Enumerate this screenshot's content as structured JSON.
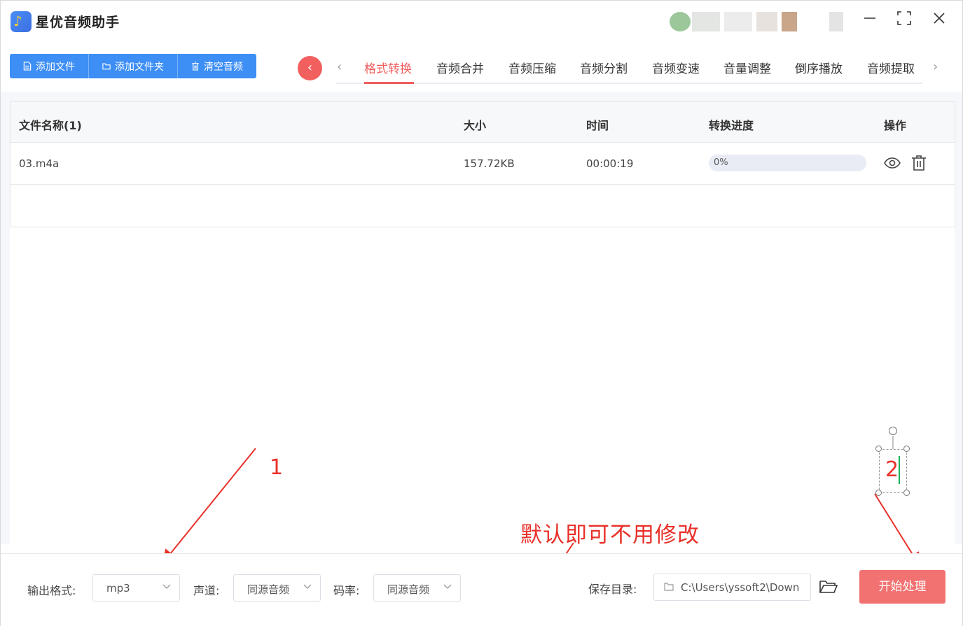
{
  "app": {
    "title": "星优音频助手"
  },
  "window_controls": {
    "minimize": "—",
    "maximize": "⛶",
    "close": "✕"
  },
  "toolbar": {
    "add_file": "添加文件",
    "add_folder": "添加文件夹",
    "clear_audio": "清空音频"
  },
  "nav": {
    "tabs": [
      "格式转换",
      "音频合并",
      "音频压缩",
      "音频分割",
      "音频变速",
      "音量调整",
      "倒序播放",
      "音频提取"
    ],
    "active_tab": "格式转换"
  },
  "table": {
    "headers": {
      "name": "文件名称(1)",
      "size": "大小",
      "time": "时间",
      "progress": "转换进度",
      "ops": "操作"
    },
    "rows": [
      {
        "name": "03.m4a",
        "size": "157.72KB",
        "time": "00:00:19",
        "progress_text": "0%",
        "progress": 0
      }
    ]
  },
  "bottom": {
    "output_format_label": "输出格式:",
    "output_format_value": "mp3",
    "channel_label": "声道:",
    "channel_value": "同源音频",
    "bitrate_label": "码率:",
    "bitrate_value": "同源音频",
    "save_dir_label": "保存目录:",
    "save_dir_value": "C:\\Users\\yssoft2\\Down",
    "start_button": "开始处理"
  },
  "annotations": {
    "step1": "1",
    "step2": "2",
    "note": "默认即可不用修改"
  },
  "colors": {
    "primary": "#3d8ef5",
    "accent": "#f05c5c",
    "start_button": "#f27171",
    "annotation": "#e8312a"
  }
}
